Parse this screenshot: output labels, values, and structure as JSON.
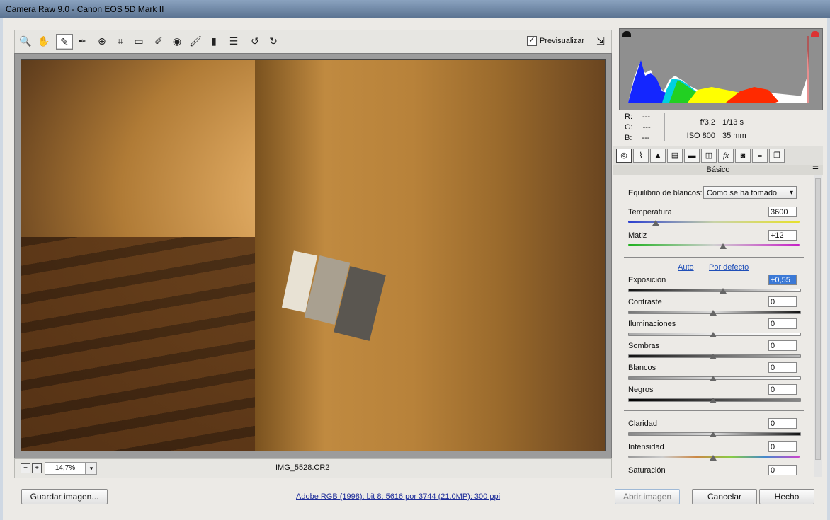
{
  "window": {
    "title": "Camera Raw 9.0 -  Canon EOS 5D Mark II"
  },
  "toolbar": {
    "tools": [
      {
        "name": "zoom-tool",
        "icon": "magnifier-icon",
        "glyph": "🔍"
      },
      {
        "name": "hand-tool",
        "icon": "hand-icon",
        "glyph": "✋"
      },
      {
        "name": "white-balance-tool",
        "icon": "eyedropper-icon",
        "glyph": "✎"
      },
      {
        "name": "color-sampler-tool",
        "icon": "color-sampler-icon",
        "glyph": "✒"
      },
      {
        "name": "targeted-adjustment-tool",
        "icon": "target-icon",
        "glyph": "⊕"
      },
      {
        "name": "crop-tool",
        "icon": "crop-icon",
        "glyph": "⌗"
      },
      {
        "name": "straighten-tool",
        "icon": "level-icon",
        "glyph": "▭"
      },
      {
        "name": "spot-removal-tool",
        "icon": "brush-heal-icon",
        "glyph": "✐"
      },
      {
        "name": "red-eye-tool",
        "icon": "eye-icon",
        "glyph": "◉"
      },
      {
        "name": "adjustment-brush-tool",
        "icon": "brush-icon",
        "glyph": "🖌"
      },
      {
        "name": "graduated-filter-tool",
        "icon": "graduated-filter-icon",
        "glyph": "▮"
      },
      {
        "name": "preferences-tool",
        "icon": "list-icon",
        "glyph": "☰"
      },
      {
        "name": "rotate-left-tool",
        "icon": "rotate-ccw-icon",
        "glyph": "↺"
      },
      {
        "name": "rotate-right-tool",
        "icon": "rotate-cw-icon",
        "glyph": "↻"
      }
    ],
    "preview_label": "Previsualizar",
    "preview_checked": true
  },
  "image_status": {
    "zoom_value": "14,7%",
    "filename": "IMG_5528.CR2"
  },
  "readout": {
    "r_label": "R:",
    "r_value": "---",
    "g_label": "G:",
    "g_value": "---",
    "b_label": "B:",
    "b_value": "---",
    "aperture": "f/3,2",
    "shutter": "1/13 s",
    "iso": "ISO 800",
    "focal": "35 mm"
  },
  "panel_tabs": [
    {
      "name": "tab-basic",
      "glyph": "◎",
      "active": true
    },
    {
      "name": "tab-tone-curve",
      "glyph": "⌇"
    },
    {
      "name": "tab-detail",
      "glyph": "▲"
    },
    {
      "name": "tab-hsl",
      "glyph": "▤"
    },
    {
      "name": "tab-split-toning",
      "glyph": "▬"
    },
    {
      "name": "tab-lens-corrections",
      "glyph": "◫"
    },
    {
      "name": "tab-effects",
      "glyph": "fx"
    },
    {
      "name": "tab-camera-calibration",
      "glyph": "◙"
    },
    {
      "name": "tab-presets",
      "glyph": "≡"
    },
    {
      "name": "tab-snapshots",
      "glyph": "❐"
    }
  ],
  "panel": {
    "header": "Básico",
    "wb_label": "Equilibrio de blancos:",
    "wb_value": "Como se ha tomado",
    "temperature_label": "Temperatura",
    "temperature_value": "3600",
    "tint_label": "Matiz",
    "tint_value": "+12",
    "auto_label": "Auto",
    "default_label": "Por defecto",
    "sliders": [
      {
        "name": "exposure",
        "label": "Exposición",
        "value": "+0,55"
      },
      {
        "name": "contrast",
        "label": "Contraste",
        "value": "0"
      },
      {
        "name": "highlights",
        "label": "Iluminaciones",
        "value": "0"
      },
      {
        "name": "shadows",
        "label": "Sombras",
        "value": "0"
      },
      {
        "name": "whites",
        "label": "Blancos",
        "value": "0"
      },
      {
        "name": "blacks",
        "label": "Negros",
        "value": "0"
      }
    ],
    "presence": [
      {
        "name": "clarity",
        "label": "Claridad",
        "value": "0"
      },
      {
        "name": "vibrance",
        "label": "Intensidad",
        "value": "0"
      },
      {
        "name": "saturation",
        "label": "Saturación",
        "value": "0"
      }
    ]
  },
  "footer": {
    "save_label": "Guardar imagen...",
    "workflow_text": "Adobe RGB (1998); bit 8; 5616 por 3744 (21,0MP); 300 ppi",
    "open_label": "Abrir imagen",
    "cancel_label": "Cancelar",
    "done_label": "Hecho"
  },
  "colors": {
    "accent": "#3b79d6",
    "link": "#1f4fb8",
    "title_bar": "#5a7290"
  }
}
